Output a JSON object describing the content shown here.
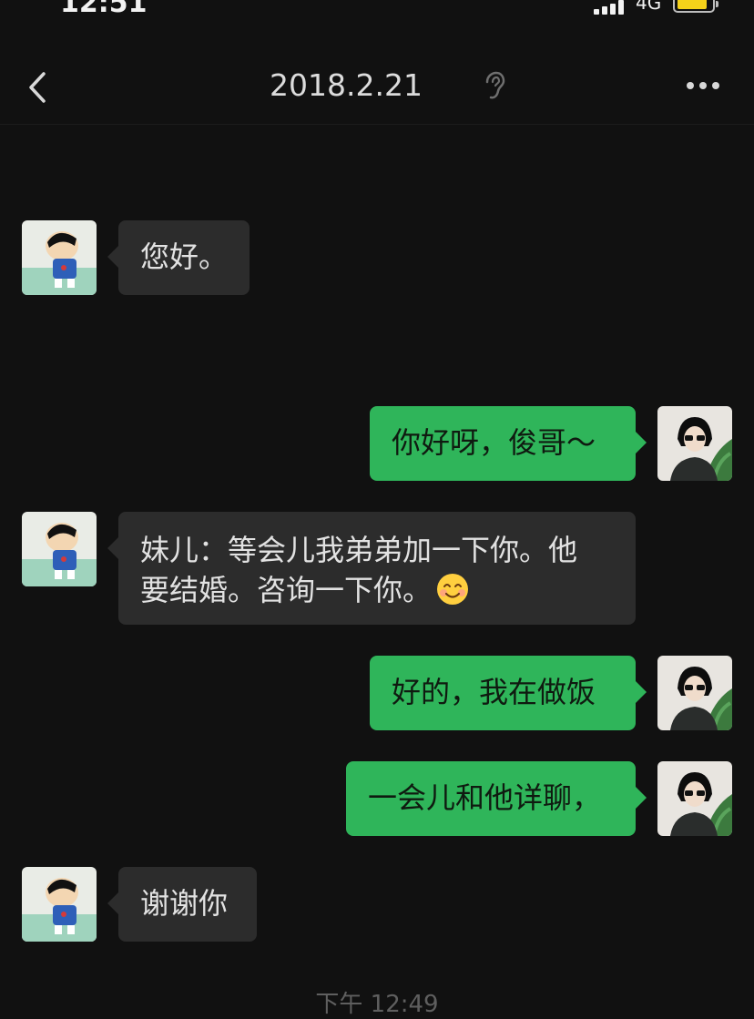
{
  "status_bar": {
    "time": "12:51",
    "network": "4G",
    "battery_color": "#f5d21a"
  },
  "nav": {
    "title": "2018.2.21",
    "back_icon": "chevron-left-icon",
    "ear_icon": "ear-icon",
    "more_icon": "more-dots-icon"
  },
  "messages": [
    {
      "side": "left",
      "text": "您好。"
    },
    {
      "side": "right",
      "text": "你好呀，俊哥～"
    },
    {
      "side": "left",
      "text_line1": "妹儿：等会儿我弟弟加一下你。他",
      "text_line2": "要结婚。咨询一下你。",
      "emoji": "smiling-face-emoji"
    },
    {
      "side": "right",
      "text": "好的，我在做饭"
    },
    {
      "side": "right",
      "text": "一会儿和他详聊，"
    },
    {
      "side": "left",
      "text": "谢谢你"
    }
  ],
  "timestamp": "下午 12:49",
  "colors": {
    "background": "#111111",
    "incoming_bubble": "#2c2c2c",
    "outgoing_bubble": "#2fb55a"
  }
}
